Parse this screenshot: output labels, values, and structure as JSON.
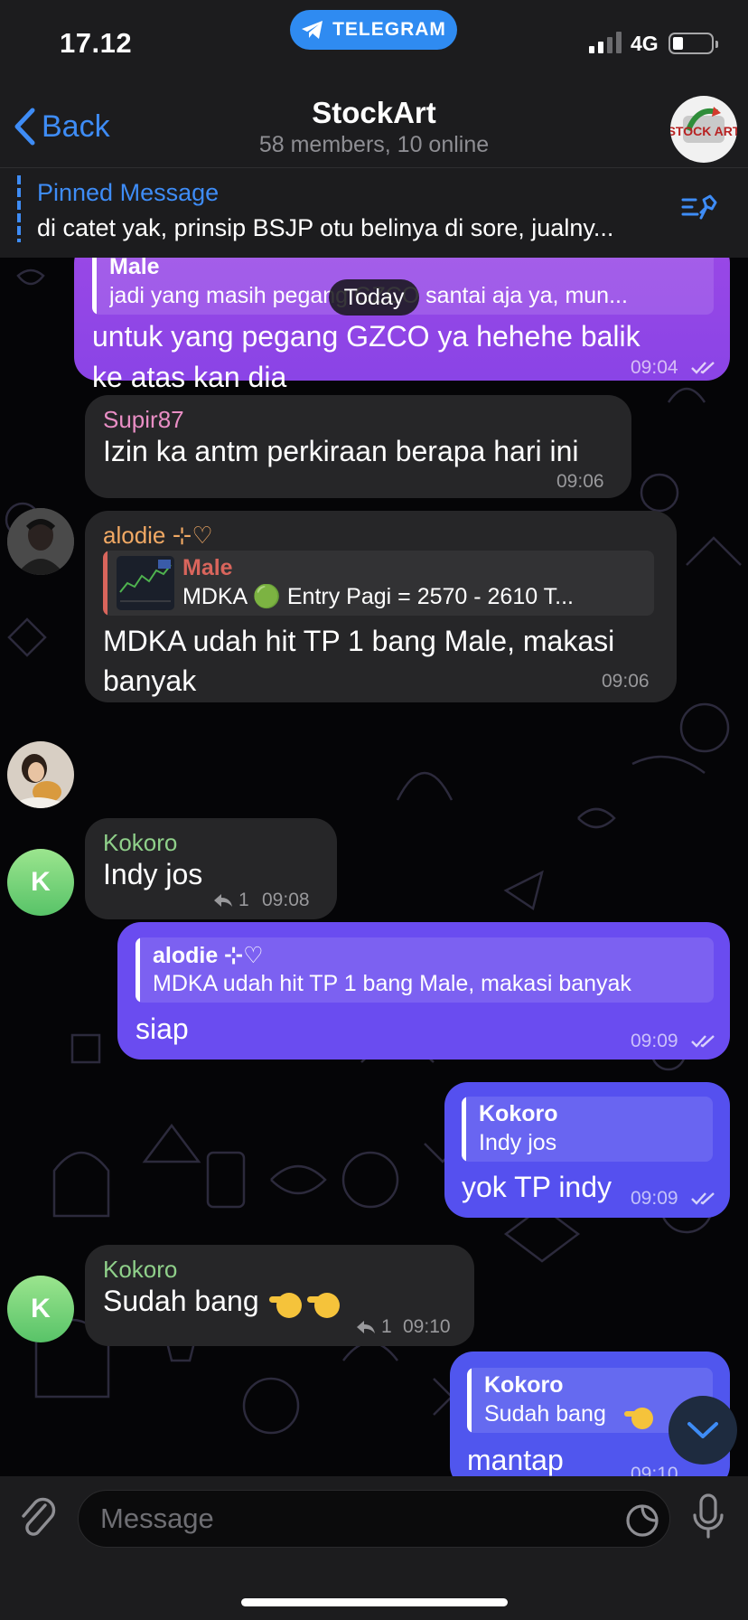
{
  "status_bar": {
    "time": "17.12",
    "app_label": "TELEGRAM",
    "network": "4G"
  },
  "header": {
    "back_label": "Back",
    "title": "StockArt",
    "subtitle": "58 members, 10 online",
    "avatar_text": "STOCK ART"
  },
  "pinned": {
    "title": "Pinned Message",
    "text": "di catet yak, prinsip BSJP otu belinya di sore, jualny..."
  },
  "date_separator": "Today",
  "messages": [
    {
      "direction": "out",
      "quote": {
        "name": "Male",
        "text": "jadi yang masih pegang GZCO santai aja ya, mun..."
      },
      "lines": [
        "untuk yang pegang GZCO ya hehehe balik",
        "ke atas kan dia"
      ],
      "time": "09:04"
    },
    {
      "direction": "in",
      "sender": "Supir87",
      "sender_color": "#e98ec5",
      "lines": [
        "Izin ka antm  perkiraan berapa hari ini"
      ],
      "time": "09:06"
    },
    {
      "direction": "in",
      "sender": "alodie ⊹♡",
      "sender_color": "#f1a964",
      "quote": {
        "name": "Male",
        "text": "MDKA 🟢 Entry Pagi = 2570 - 2610 T..."
      },
      "lines": [
        "MDKA udah hit TP 1 bang Male, makasi",
        "banyak"
      ],
      "time": "09:06"
    },
    {
      "direction": "in",
      "sender": "Kokoro",
      "sender_color": "#8fd08a",
      "avatar_letter": "K",
      "lines": [
        "Indy jos"
      ],
      "reply_count": "1",
      "time": "09:08"
    },
    {
      "direction": "out",
      "quote": {
        "name": "alodie ⊹♡",
        "text": "MDKA udah hit TP 1 bang Male, makasi banyak"
      },
      "lines": [
        "siap"
      ],
      "time": "09:09"
    },
    {
      "direction": "out",
      "quote": {
        "name": "Kokoro",
        "text": "Indy jos"
      },
      "lines": [
        "yok TP indy"
      ],
      "time": "09:09"
    },
    {
      "direction": "in",
      "sender": "Kokoro",
      "sender_color": "#8fd08a",
      "avatar_letter": "K",
      "lines": [
        "Sudah bang"
      ],
      "reply_count": "1",
      "time": "09:10"
    },
    {
      "direction": "out",
      "quote": {
        "name": "Kokoro",
        "text": "Sudah bang"
      },
      "lines": [
        "mantap"
      ],
      "time": "09:10"
    }
  ],
  "composer": {
    "placeholder": "Message"
  },
  "colors": {
    "accent": "#3e8cf6",
    "incoming_bubble": "#262628",
    "outgoing_bubble_top": "#9a48e6",
    "outgoing_bubble_bottom": "#5056ee"
  },
  "icons": [
    "telegram-icon",
    "signal-icon",
    "battery-icon",
    "back-chevron-icon",
    "pin-icon",
    "read-ticks-icon",
    "reply-icon",
    "hand-emoji-icon",
    "green-circle-icon",
    "chevron-down-icon",
    "attach-icon",
    "sticker-icon",
    "mic-icon"
  ]
}
